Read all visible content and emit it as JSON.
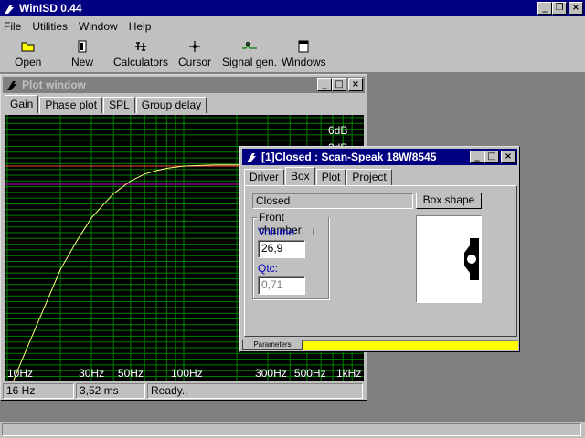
{
  "app": {
    "title": "WinISD 0.44",
    "menu": [
      "File",
      "Utilities",
      "Window",
      "Help"
    ],
    "toolbar": [
      "Open",
      "New",
      "Calculators",
      "Cursor",
      "Signal gen.",
      "Windows"
    ]
  },
  "plot_window": {
    "title": "Plot window",
    "tabs": [
      "Gain",
      "Phase plot",
      "SPL",
      "Group delay"
    ],
    "selected_tab": "Gain",
    "y_labels": [
      "6dB",
      "3dB"
    ],
    "x_labels": [
      "10Hz",
      "30Hz",
      "50Hz",
      "100Hz",
      "300Hz",
      "500Hz",
      "1kHz"
    ],
    "status": [
      "16 Hz",
      "3,52 ms",
      "Ready.."
    ]
  },
  "box_window": {
    "title": "[1]Closed : Scan-Speak 18W/8545",
    "tabs": [
      "Driver",
      "Box",
      "Plot",
      "Project"
    ],
    "selected_tab": "Box",
    "box_type": "Closed",
    "box_shape_button": "Box shape",
    "front_chamber": {
      "legend": "Front chamber:",
      "volume_label": "Volume:",
      "volume_value": "26,9",
      "volume_unit": "l",
      "qtc_label": "Qtc:",
      "qtc_value": "0,71"
    },
    "bottom_tab": "Parameters"
  },
  "colors": {
    "grid": "#008000",
    "curve": "#ffff80",
    "ref_line": "#ff4040",
    "plot_bg": "#000000",
    "status_strip": "#ffff00"
  },
  "chart_data": {
    "type": "line",
    "x_scale": "log",
    "xlim": [
      10,
      1000
    ],
    "x_ticks": [
      10,
      30,
      50,
      100,
      300,
      500,
      1000
    ],
    "series": [
      {
        "x": [
          10,
          12,
          15,
          20,
          25,
          30,
          40,
          50,
          60,
          70,
          80,
          100,
          150,
          200,
          300
        ],
        "y": [
          -20,
          -17,
          -13.5,
          -9,
          -6.4,
          -4.5,
          -2.4,
          -1.3,
          -0.7,
          -0.4,
          -0.2,
          0,
          0.1,
          0.1,
          0.1
        ]
      }
    ]
  }
}
